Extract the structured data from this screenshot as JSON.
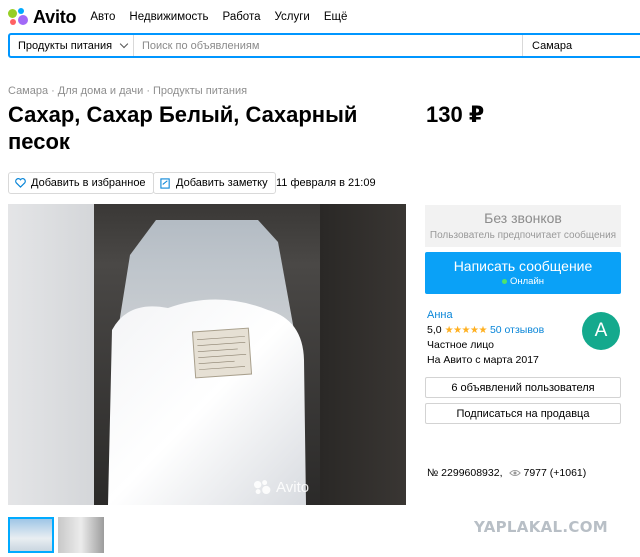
{
  "header": {
    "logo_text": "Avito",
    "nav": [
      "Авто",
      "Недвижимость",
      "Работа",
      "Услуги",
      "Ещё"
    ]
  },
  "search": {
    "category": "Продукты питания",
    "placeholder": "Поиск по объявлениям",
    "city": "Самара"
  },
  "breadcrumb": [
    "Самара",
    "Для дома и дачи",
    "Продукты питания"
  ],
  "listing": {
    "title": "Сахар, Сахар Белый, Сахарный песок",
    "price": "130 ₽",
    "add_favorite": "Добавить в избранное",
    "add_note": "Добавить заметку",
    "date": "11 февраля в 21:09",
    "watermark": "Avito",
    "number": "№ 2299608932,",
    "views": "7977 (+1061)"
  },
  "contact": {
    "no_calls": "Без звонков",
    "no_calls_sub": "Пользователь предпочитает сообщения",
    "message_button": "Написать сообщение",
    "online": "Онлайн"
  },
  "seller": {
    "name": "Анна",
    "rating": "5,0",
    "stars": 5,
    "reviews": "50 отзывов",
    "type": "Частное лицо",
    "since": "На Авито с марта 2017",
    "avatar_letter": "A",
    "listings_button": "6 объявлений пользователя",
    "subscribe_button": "Подписаться на продавца"
  },
  "site_watermark": "YAPLAKAL.COM",
  "colors": {
    "accent": "#0096ff",
    "message_button": "#0aa1f7",
    "avatar": "#14a98d",
    "stars": "#ffb021",
    "link": "#0a86d8"
  }
}
